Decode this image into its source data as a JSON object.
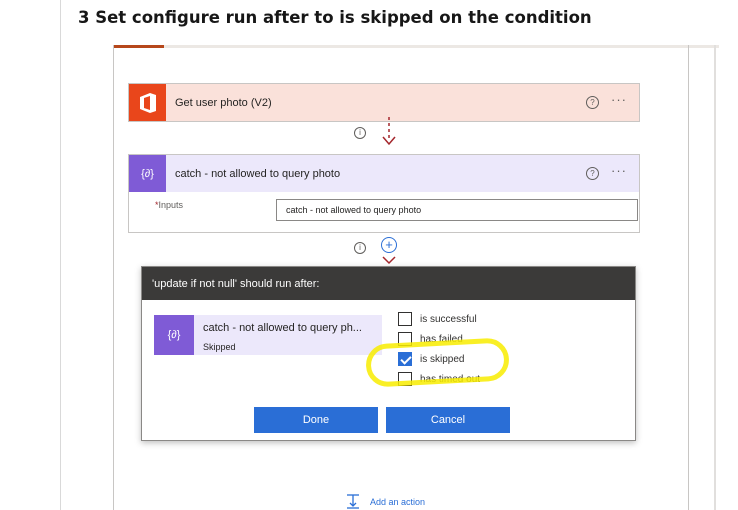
{
  "heading": "3 Set configure run after to is skipped on the condition",
  "flow": {
    "card1": {
      "title": "Get user photo (V2)",
      "icon": "office-logo-icon",
      "color": "#e9461b"
    },
    "card2": {
      "title": "catch - not allowed to query photo",
      "icon": "compose-data-operation-icon",
      "color": "#7f5bd6",
      "inputs_required_mark": "*",
      "inputs_label": "Inputs",
      "inputs_value": "catch - not allowed to query photo"
    },
    "dialog": {
      "title": "'update if not null' should run after:",
      "run_after_action": "catch - not allowed to query ph...",
      "run_after_status": "Skipped",
      "options": [
        {
          "label": "is successful",
          "checked": false
        },
        {
          "label": "has failed",
          "checked": false
        },
        {
          "label": "is skipped",
          "checked": true
        },
        {
          "label": "has timed out",
          "checked": false
        }
      ],
      "done_label": "Done",
      "cancel_label": "Cancel"
    },
    "add_action_label": "Add an action"
  },
  "colors": {
    "accent_blue": "#2a6ed6",
    "highlight": "#f8ec00",
    "dialog_header": "#3b3a39"
  }
}
